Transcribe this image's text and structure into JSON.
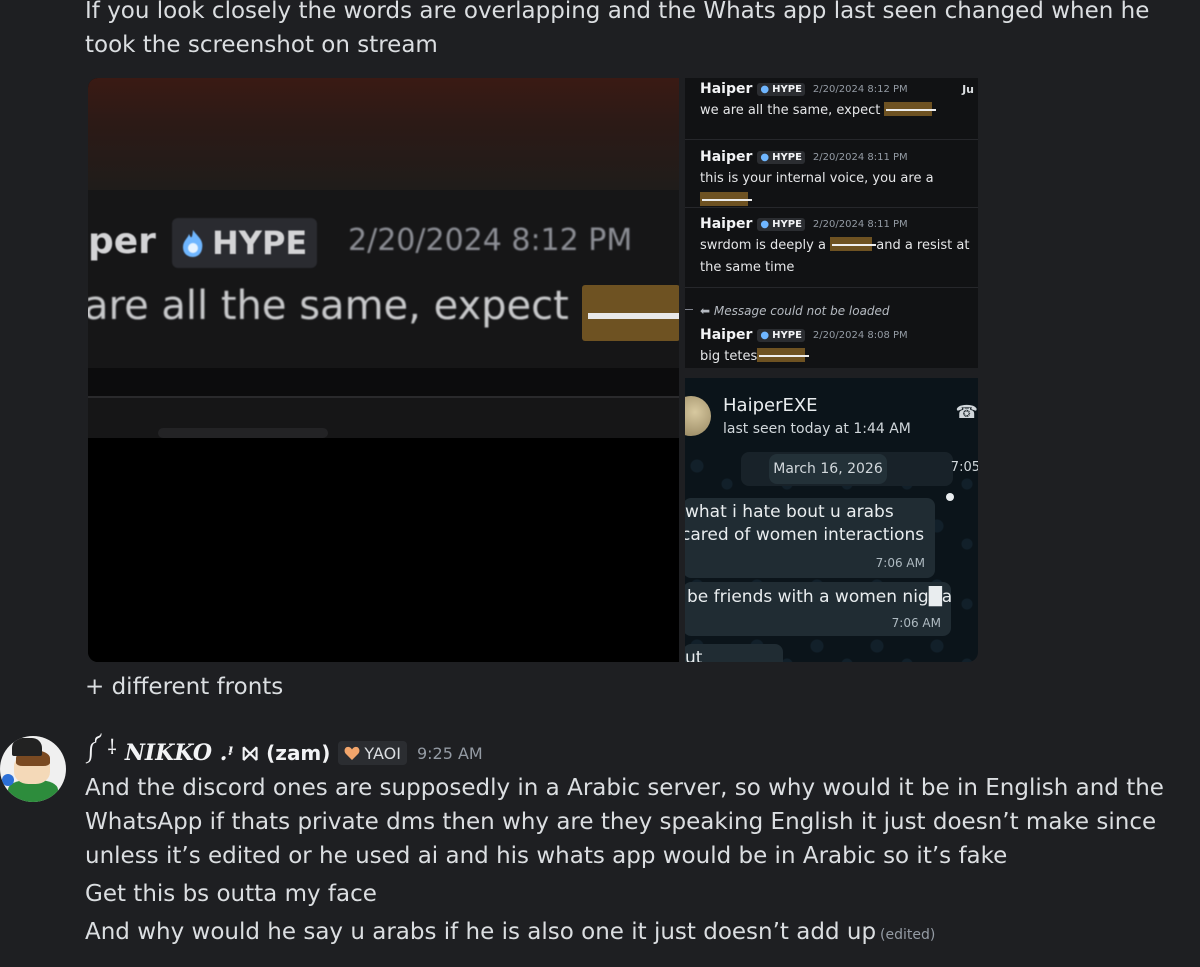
{
  "intro_message": "If you look closely the words are overlapping and the Whats app last seen changed when he took the screenshot on stream",
  "zoomed_screenshot": {
    "name_fragment": "per",
    "badge": "HYPE",
    "date": "2/20/2024 8:12 PM",
    "message_fragment": "are all the same, expect"
  },
  "discord_screenshot": {
    "corner_text": "Ju",
    "reply_notice": "Message could not be loaded",
    "messages": [
      {
        "author": "Haiper",
        "badge": "HYPE",
        "date": "2/20/2024 8:12 PM",
        "text": "we are all the same, expect"
      },
      {
        "author": "Haiper",
        "badge": "HYPE",
        "date": "2/20/2024 8:11 PM",
        "text": "this is your internal voice, you are a"
      },
      {
        "author": "Haiper",
        "badge": "HYPE",
        "date": "2/20/2024 8:11 PM",
        "text_before": "swrdom is deeply a",
        "text_after": "and a resist at the same time"
      },
      {
        "author": "Haiper",
        "badge": "HYPE",
        "date": "2/20/2024 8:08 PM",
        "text": "big tetes"
      }
    ]
  },
  "whatsapp_screenshot": {
    "contact_name": "HaiperEXE",
    "status": "last seen today at 1:44 AM",
    "date_banner": "March 16, 2026",
    "top_time": "7:05",
    "bubbles": [
      {
        "line1": "what i hate bout u arabs",
        "line2": "cared of women interactions",
        "time": "7:06 AM"
      },
      {
        "text": "be friends with a women nig█a",
        "time": "7:06 AM"
      }
    ],
    "partial_bubble": "ut"
  },
  "followup_message": "+ different fronts",
  "message": {
    "prefix_symbols": "༼ ⸸",
    "username": "NIKKO .ᵎ",
    "username_tail": "(zam)",
    "tag": "YAOI",
    "timestamp": "9:25 AM",
    "lines": [
      "And the discord ones are supposedly in a Arabic server, so why would it be in English and the WhatsApp if thats private dms then why are they speaking English it just doesn’t make since unless it’s edited or he used ai and his whats app would be in Arabic so it’s fake",
      "Get this bs outta my face",
      "And why would he say u arabs if he is also one it just doesn’t add up"
    ],
    "edited_label": "(edited)"
  },
  "colors": {
    "background": "#1e1f22",
    "text": "#dbdee1",
    "muted": "#949ba4",
    "censor": "#6e5222",
    "whatsapp_bg": "#0b141a"
  }
}
